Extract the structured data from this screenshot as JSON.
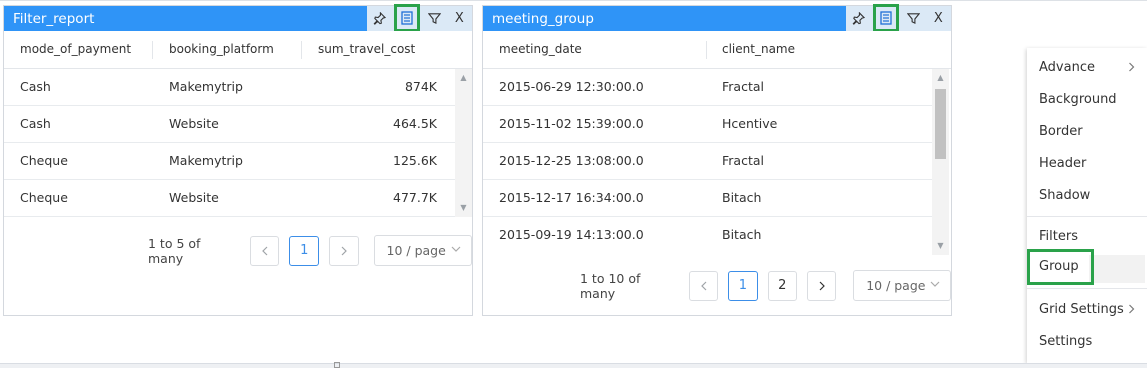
{
  "panels": [
    {
      "title": "Filter_report",
      "columns": [
        "mode_of_payment",
        "booking_platform",
        "sum_travel_cost"
      ],
      "rows": [
        [
          "Cash",
          "Makemytrip",
          "874K"
        ],
        [
          "Cash",
          "Website",
          "464.5K"
        ],
        [
          "Cheque",
          "Makemytrip",
          "125.6K"
        ],
        [
          "Cheque",
          "Website",
          "477.7K"
        ]
      ],
      "pager": {
        "info": "1 to 5 of many",
        "pages": [
          "1"
        ],
        "active": "1",
        "per_page": "10 / page"
      }
    },
    {
      "title": "meeting_group",
      "columns": [
        "meeting_date",
        "client_name"
      ],
      "rows": [
        [
          "2015-06-29 12:30:00.0",
          "Fractal"
        ],
        [
          "2015-11-02 15:39:00.0",
          "Hcentive"
        ],
        [
          "2015-12-25 13:08:00.0",
          "Fractal"
        ],
        [
          "2015-12-17 16:34:00.0",
          "Bitach"
        ],
        [
          "2015-09-19 14:13:00.0",
          "Bitach"
        ]
      ],
      "pager": {
        "info": "1 to 10 of many",
        "pages": [
          "1",
          "2"
        ],
        "active": "1",
        "per_page": "10 / page"
      }
    }
  ],
  "icons": {
    "pin": "pin-icon",
    "group": "group-icon",
    "filter": "filter-icon",
    "close": "close-icon",
    "prev": "chevron-left-icon",
    "next": "chevron-right-icon"
  },
  "title_close": "X",
  "context_menu": {
    "items": [
      {
        "label": "Advance",
        "submenu": true
      },
      {
        "label": "Background",
        "submenu": false
      },
      {
        "label": "Border",
        "submenu": false
      },
      {
        "label": "Header",
        "submenu": false
      },
      {
        "label": "Shadow",
        "submenu": false
      },
      {
        "label": "Filters",
        "submenu": false
      },
      {
        "label": "Group",
        "submenu": false,
        "highlighted": true
      },
      {
        "label": "Grid Settings",
        "submenu": true
      },
      {
        "label": "Settings",
        "submenu": false
      }
    ]
  },
  "colors": {
    "title_bar": "#2f94f7",
    "highlight_box": "#2aa24a",
    "active_page": "#3c8ee8"
  }
}
